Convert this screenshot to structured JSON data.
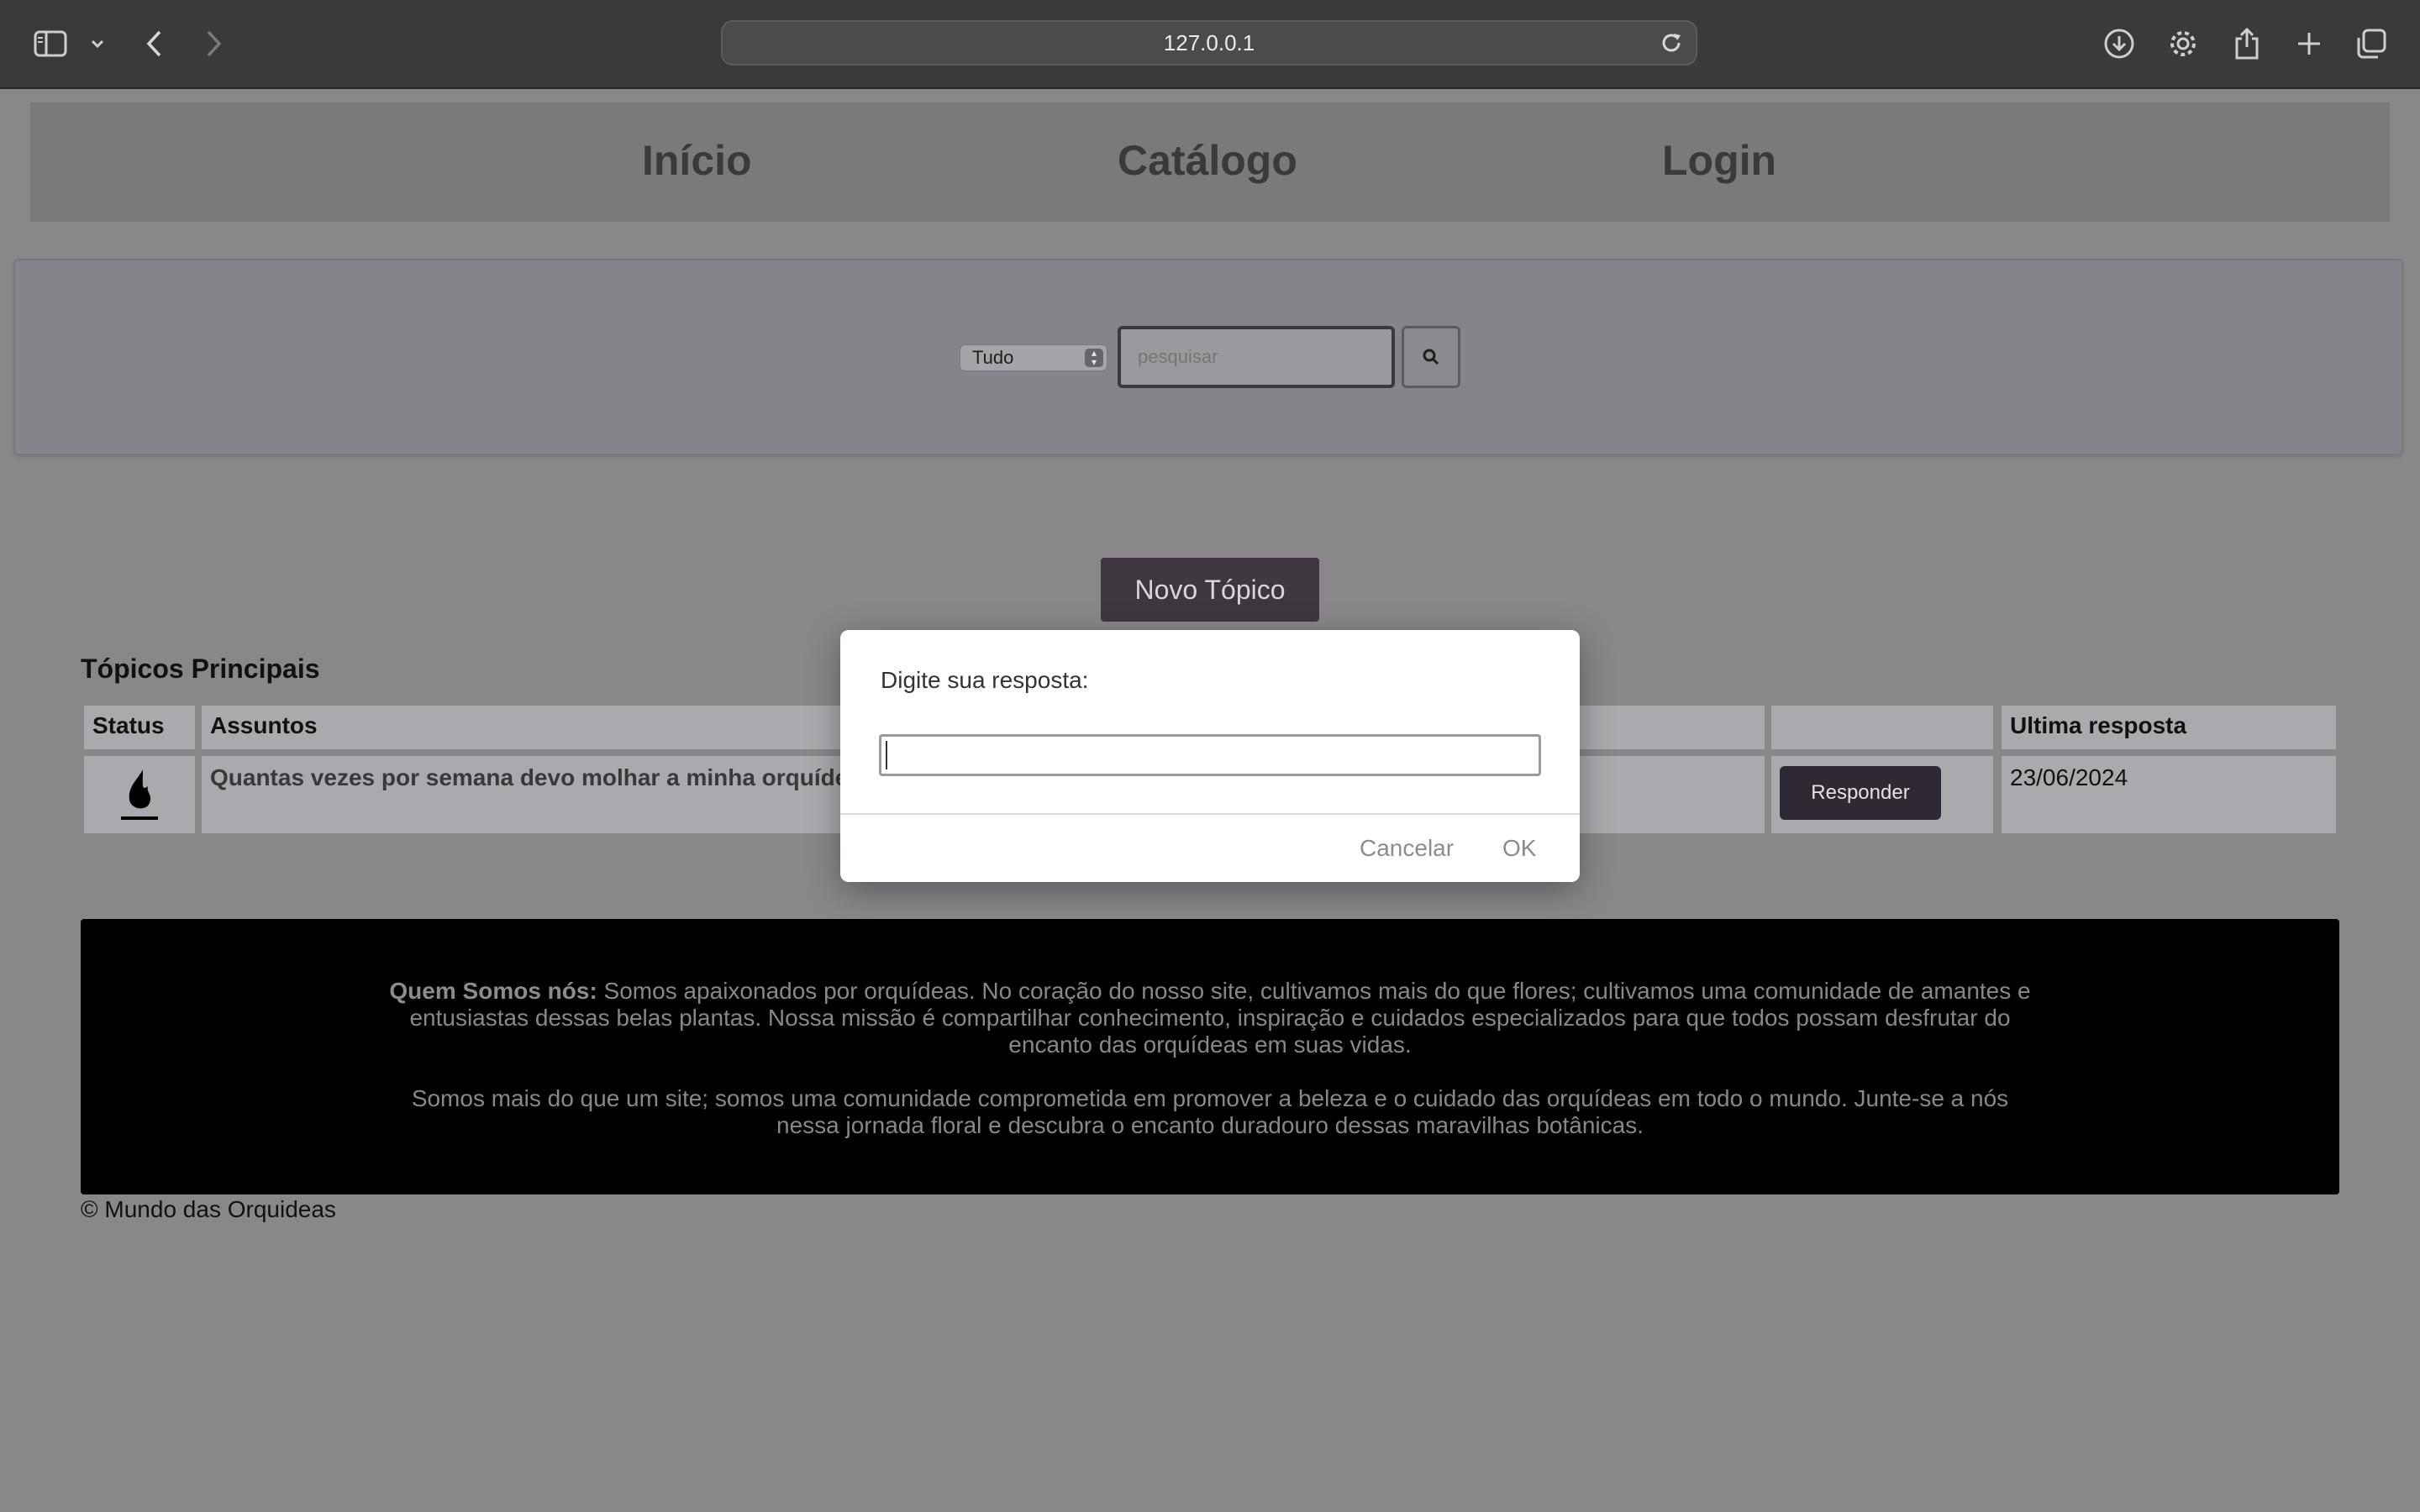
{
  "browser": {
    "address": "127.0.0.1"
  },
  "nav": {
    "inicio": "Início",
    "catalogo": "Catálogo",
    "login": "Login"
  },
  "search": {
    "filter_value": "Tudo",
    "placeholder": "pesquisar"
  },
  "forum": {
    "new_topic_label": "Novo Tópico",
    "section_title": "Tópicos Principais",
    "columns": {
      "status": "Status",
      "subjects": "Assuntos",
      "last_reply": "Ultima resposta"
    },
    "rows": [
      {
        "subject": "Quantas vezes por semana devo molhar a minha orquídea?",
        "reply_label": "Responder",
        "last_reply": "23/06/2024"
      }
    ]
  },
  "footer": {
    "about_heading": "Quem Somos nós:",
    "about_text": " Somos apaixonados por orquídeas. No coração do nosso site, cultivamos mais do que flores; cultivamos uma comunidade de amantes e entusiastas dessas belas plantas. Nossa missão é compartilhar conhecimento, inspiração e cuidados especializados para que todos possam desfrutar do encanto das orquídeas em suas vidas.",
    "second_paragraph": "Somos mais do que um site; somos uma comunidade comprometida em promover a beleza e o cuidado das orquídeas em todo o mundo. Junte-se a nós nessa jornada floral e descubra o encanto duradouro dessas maravilhas botânicas.",
    "copyright": "© Mundo das Orquideas"
  },
  "dialog": {
    "message": "Digite sua resposta:",
    "input_value": "",
    "cancel_label": "Cancelar",
    "ok_label": "OK"
  }
}
